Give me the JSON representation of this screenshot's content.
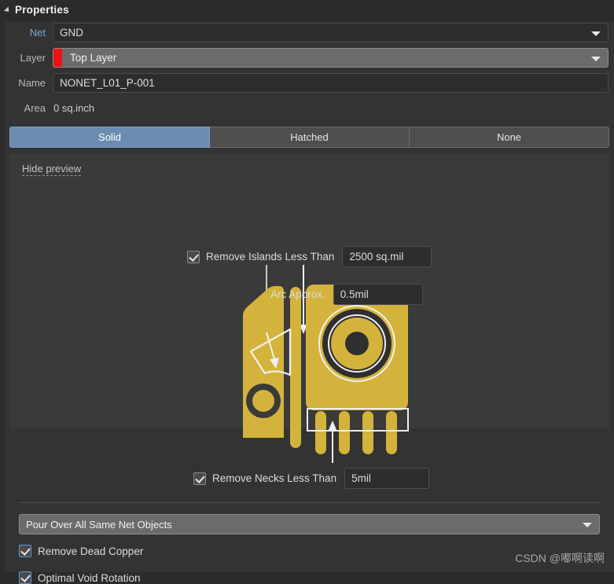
{
  "panel": {
    "title": "Properties",
    "collapse_icon": "triangle-collapse-icon"
  },
  "fields": {
    "net": {
      "label": "Net",
      "value": "GND",
      "dropdown_icon": "chevron-down-icon"
    },
    "layer": {
      "label": "Layer",
      "value": "Top Layer",
      "swatch_color": "#ee1111",
      "dropdown_icon": "chevron-down-icon"
    },
    "name": {
      "label": "Name",
      "value": "NONET_L01_P-001"
    },
    "area": {
      "label": "Area",
      "value": "0 sq.inch"
    }
  },
  "fill_mode_tabs": [
    {
      "label": "Solid",
      "active": true
    },
    {
      "label": "Hatched",
      "active": false
    },
    {
      "label": "None",
      "active": false
    }
  ],
  "preview": {
    "hide_preview_link": "Hide preview",
    "remove_islands": {
      "label": "Remove Islands Less Than",
      "checked": true,
      "value": "2500 sq.mil"
    },
    "arc_approx": {
      "label": "Arc Approx.",
      "value": "0.5mil"
    },
    "remove_necks": {
      "label": "Remove Necks Less Than",
      "checked": true,
      "value": "5mil"
    },
    "graphic": {
      "name": "pcb-copper-pour-preview",
      "copper_color": "#d4b33c",
      "outline_color": "#f0f0f0",
      "background_color": "#3a3a3a"
    }
  },
  "pour_mode": {
    "value": "Pour Over All Same Net Objects",
    "dropdown_icon": "chevron-down-icon"
  },
  "options": [
    {
      "label": "Remove Dead Copper",
      "checked": true
    },
    {
      "label": "Optimal Void Rotation",
      "checked": true
    }
  ],
  "watermark": {
    "text": "CSDN @嘟啊读啊"
  },
  "colors": {
    "accent_blue": "#6b8cb0",
    "label_blue": "#77a8d6",
    "panel_bg": "#333333",
    "window_bg": "#2b2b2b",
    "preview_bg": "#3a3a3a",
    "copper": "#d4b33c",
    "layer_red": "#ee1111"
  }
}
